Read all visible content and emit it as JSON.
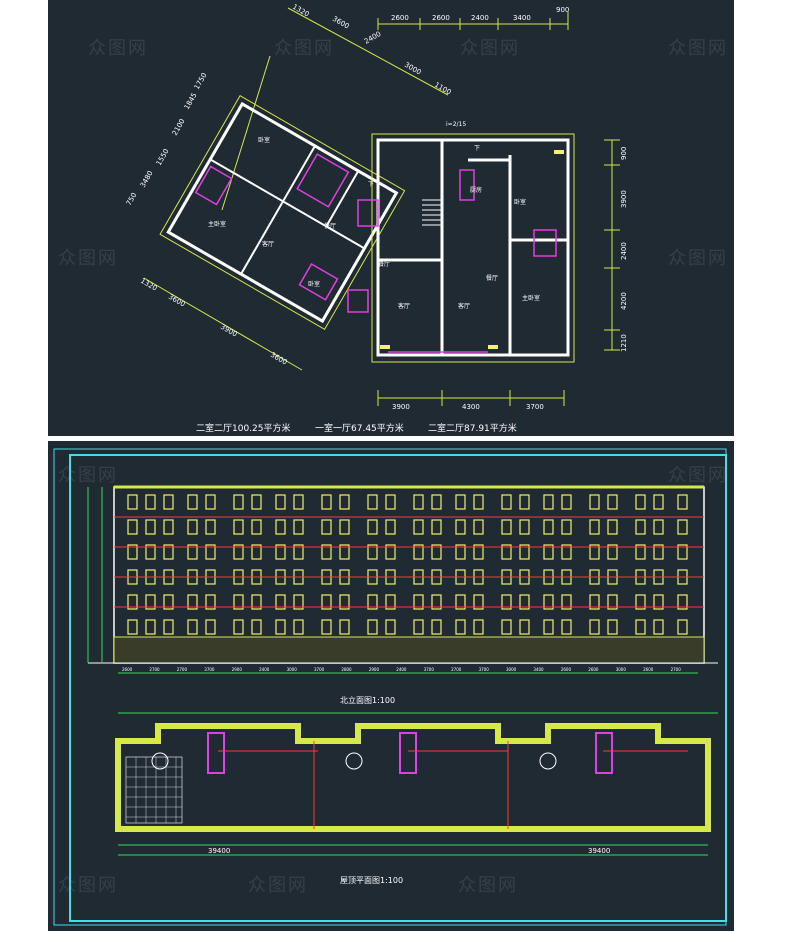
{
  "watermark": "众图网",
  "plan": {
    "captions": [
      "二室二厅100.25平方米",
      "一室一厅67.45平方米",
      "二室二厅87.91平方米"
    ],
    "top_dims": [
      "2600",
      "2600",
      "2400",
      "3400",
      "900"
    ],
    "bottom_dims": [
      "3900",
      "4300",
      "3700"
    ],
    "right_dims": [
      "900",
      "3900",
      "2400",
      "4200",
      "1210"
    ],
    "rot_top_dims": [
      "1320",
      "3600",
      "2400",
      "3000",
      "1100"
    ],
    "rot_left_dims": [
      "1750",
      "1845",
      "2100",
      "1550",
      "3480",
      "750"
    ],
    "rot_bottom_dims": [
      "1320",
      "3600",
      "3900",
      "3600"
    ],
    "slope": "i=2/15",
    "down_label": "下",
    "rooms": [
      "卧室",
      "主卧室",
      "客厅",
      "餐厅",
      "卧室",
      "餐厅",
      "客厅",
      "客厅",
      "餐厅",
      "厨房",
      "卧室",
      "主卧室"
    ]
  },
  "elevation": {
    "title": "北立面图1:100",
    "dims": [
      "2600",
      "2700",
      "2700",
      "3700",
      "2900",
      "2400",
      "3000",
      "3700",
      "2800",
      "2900",
      "2400",
      "3700",
      "2700",
      "3700",
      "3000",
      "3400",
      "2600",
      "2600",
      "3000",
      "2600",
      "2700"
    ]
  },
  "roof": {
    "title": "屋顶平面图1:100",
    "total_dims": [
      "39400",
      "39400"
    ]
  },
  "colors": {
    "background": "#1f2a33",
    "wall": "#ffffff",
    "dimension": "#d7e84a",
    "fixture": "#e040e0",
    "window": "#f7f06a",
    "frame": "#3fe0e8",
    "axis": "#2ee05a",
    "red": "#ff3a3a"
  }
}
